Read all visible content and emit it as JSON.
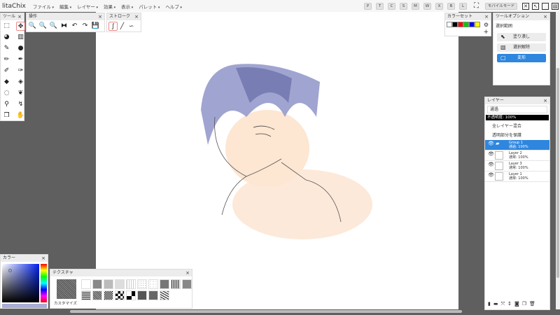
{
  "app": {
    "title": "litaChix"
  },
  "menu": [
    "ファイル",
    "編集",
    "レイヤー",
    "効果",
    "表示",
    "パレット",
    "ヘルプ"
  ],
  "mode_buttons": [
    "P",
    "T",
    "C",
    "S",
    "M",
    "W",
    "X",
    "B",
    "L"
  ],
  "mobile_mode": "モバイルモード",
  "tools_panel": {
    "title": "ツール",
    "icons": [
      "select-rect-icon",
      "move-icon",
      "fill-bucket-icon",
      "gradient-icon",
      "eyedropper-icon",
      "water-drop-icon",
      "pencil-icon",
      "pen-icon",
      "airbrush-icon",
      "marker-icon",
      "eraser-icon",
      "soft-eraser-icon",
      "lasso-icon",
      "blend-icon",
      "brush-icon",
      "smudge-icon",
      "copy-layer-icon",
      "hand-icon"
    ],
    "selected": "move-icon"
  },
  "ops_panel": {
    "title": "操作",
    "icons": [
      "zoom-in-icon",
      "zoom-out-icon",
      "zoom-reset-icon",
      "flip-icon",
      "undo-icon",
      "redo-icon",
      "save-icon"
    ]
  },
  "stroke_panel": {
    "title": "ストローク",
    "icons": [
      "curve-stroke-icon",
      "line-stroke-icon",
      "freehand-stroke-icon"
    ]
  },
  "colorset_panel": {
    "title": "カラーセット",
    "colors": [
      "#ffffff",
      "#000000",
      "#ff0000",
      "#00cc00",
      "#0000ff",
      "#ffff00"
    ]
  },
  "tool_options": {
    "title": "ツールオプション",
    "section": "選択範囲",
    "buttons": [
      {
        "label": "塗り潰し",
        "active": false
      },
      {
        "label": "選択解除",
        "active": false
      },
      {
        "label": "変形",
        "active": true
      }
    ]
  },
  "layers_panel": {
    "title": "レイヤー",
    "blend_mode": "通過",
    "opacity": "不透明度: 100%",
    "options": [
      "全レイヤー混合",
      "透明部分を保護"
    ],
    "layers": [
      {
        "name": "Group 1",
        "info": "通過: 100%",
        "active": true,
        "folder": true
      },
      {
        "name": "Layer 2",
        "info": "通常: 100%"
      },
      {
        "name": "Layer 3",
        "info": "通常: 100%"
      },
      {
        "name": "Layer 1",
        "info": "通常: 100%"
      }
    ]
  },
  "color_panel": {
    "title": "カラー",
    "current": "#a9add3"
  },
  "texture_panel": {
    "title": "テクスチャ",
    "customize": "カスタマイズ"
  }
}
